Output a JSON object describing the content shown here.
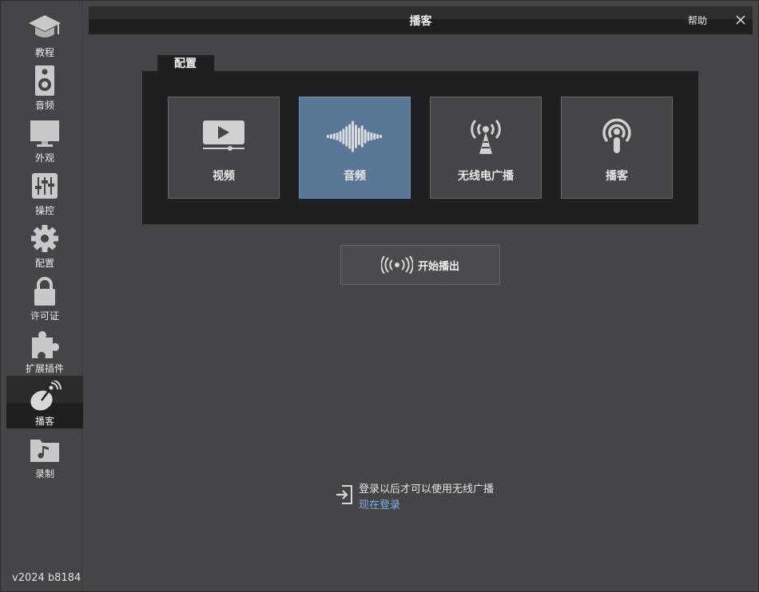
{
  "sidebar": {
    "items": [
      {
        "label": "教程",
        "icon": "graduation-cap-icon"
      },
      {
        "label": "音频",
        "icon": "speaker-icon"
      },
      {
        "label": "外观",
        "icon": "monitor-icon"
      },
      {
        "label": "操控",
        "icon": "sliders-icon"
      },
      {
        "label": "配置",
        "icon": "gear-icon"
      },
      {
        "label": "许可证",
        "icon": "lock-icon"
      },
      {
        "label": "扩展插件",
        "icon": "puzzle-icon"
      },
      {
        "label": "播客",
        "icon": "satellite-dish-icon",
        "active": true
      },
      {
        "label": "录制",
        "icon": "music-folder-icon"
      }
    ],
    "version": "v2024 b8184"
  },
  "titlebar": {
    "title": "播客",
    "help": "帮助",
    "close": "✕"
  },
  "config": {
    "tab_label": "配置",
    "cards": [
      {
        "label": "视频",
        "icon": "video-player-icon"
      },
      {
        "label": "音频",
        "icon": "audio-waveform-icon",
        "selected": true
      },
      {
        "label": "无线电广播",
        "icon": "radio-tower-icon"
      },
      {
        "label": "播客",
        "icon": "podcast-icon"
      }
    ]
  },
  "start_button": {
    "label": "开始播出",
    "icon": "broadcast-waves-icon"
  },
  "login_notice": {
    "message": "登录以后才可以使用无线广播",
    "link": "现在登录",
    "icon": "sign-in-icon"
  },
  "colors": {
    "background": "#444548",
    "panel": "#1f1f21",
    "selected_card": "#5a7797",
    "link": "#7ab0e6"
  }
}
